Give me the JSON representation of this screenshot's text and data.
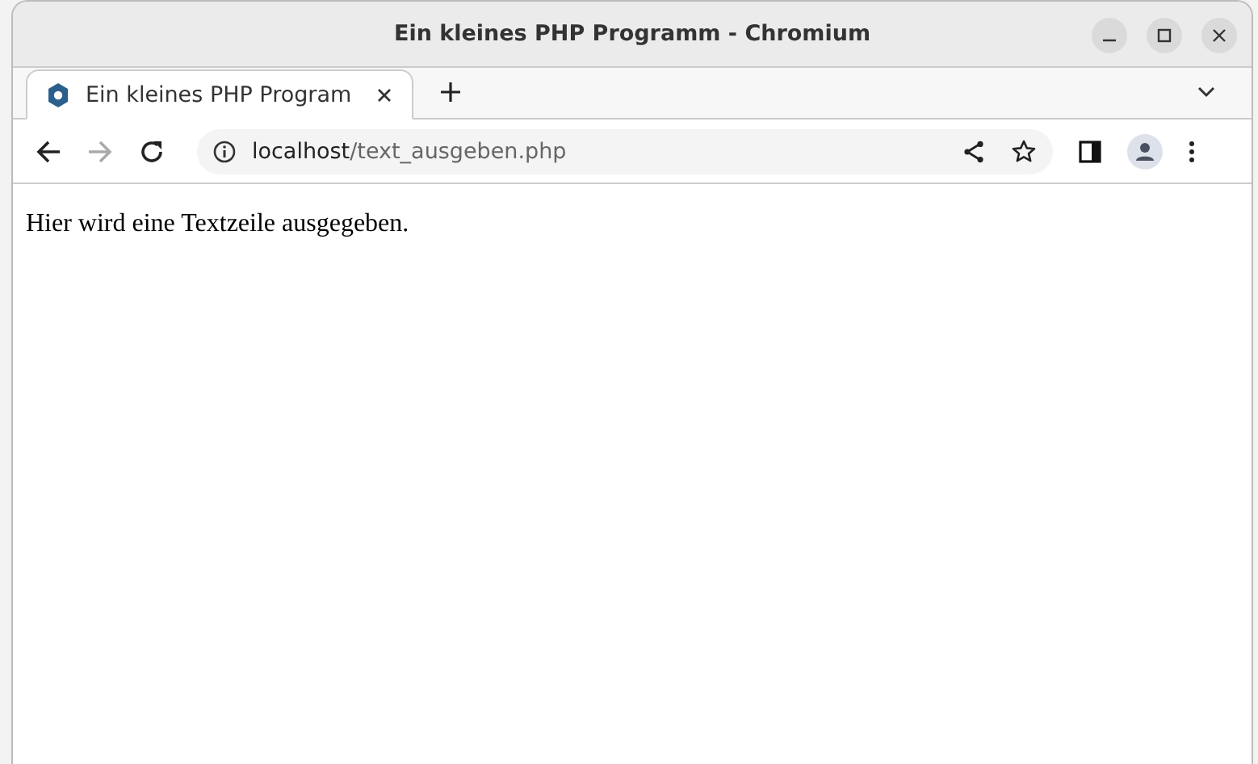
{
  "window": {
    "title": "Ein kleines PHP Programm - Chromium"
  },
  "tabs": [
    {
      "label": "Ein kleines PHP Program",
      "selected": true
    }
  ],
  "toolbar": {
    "back": {
      "disabled": false
    },
    "forward": {
      "disabled": true
    },
    "reload": {
      "disabled": false
    }
  },
  "address": {
    "host": "localhost",
    "path": "/text_ausgeben.php"
  },
  "page": {
    "text": "Hier wird eine Textzeile ausgegeben."
  }
}
